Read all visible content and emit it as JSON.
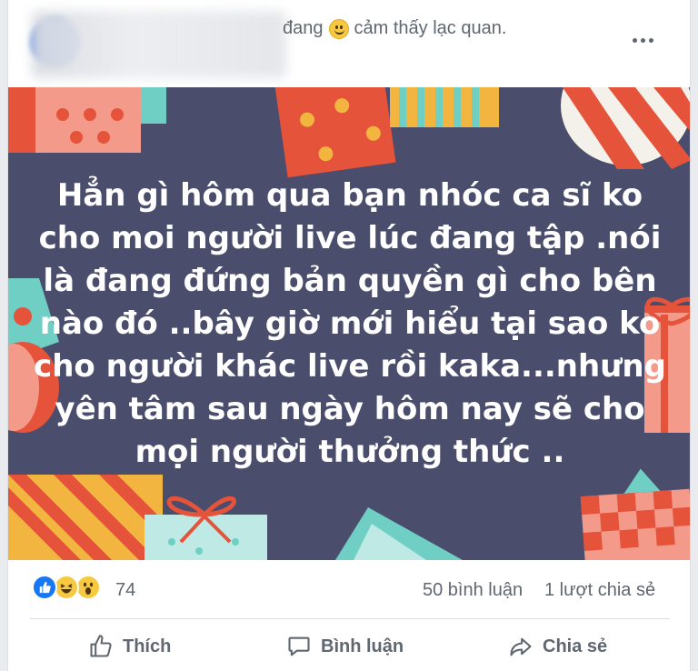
{
  "header": {
    "feeling_prefix": "đang",
    "feeling_text": "cảm thấy lạc quan.",
    "feeling_icon": "smile-emoji-icon",
    "more_icon": "more-options-icon"
  },
  "post": {
    "text": "Hẳn gì hôm qua bạn nhóc ca sĩ ko cho moi người live lúc đang tập .nói là đang đứng bản quyền gì cho bên nào đó ..bây giờ mới hiểu tại sao ko cho người khác live rồi kaka...nhưng yên tâm sau ngày hôm nay sẽ cho mọi người thưởng thức ..",
    "background_color": "#4a4d6b"
  },
  "reactions": {
    "icons": [
      "like-reaction-icon",
      "haha-reaction-icon",
      "wow-reaction-icon"
    ],
    "count": "74",
    "comments": "50 bình luận",
    "shares": "1 lượt chia sẻ"
  },
  "actions": {
    "like_label": "Thích",
    "comment_label": "Bình luận",
    "share_label": "Chia sẻ"
  },
  "colors": {
    "accent": "#1877f2",
    "muted_text": "#606770"
  }
}
